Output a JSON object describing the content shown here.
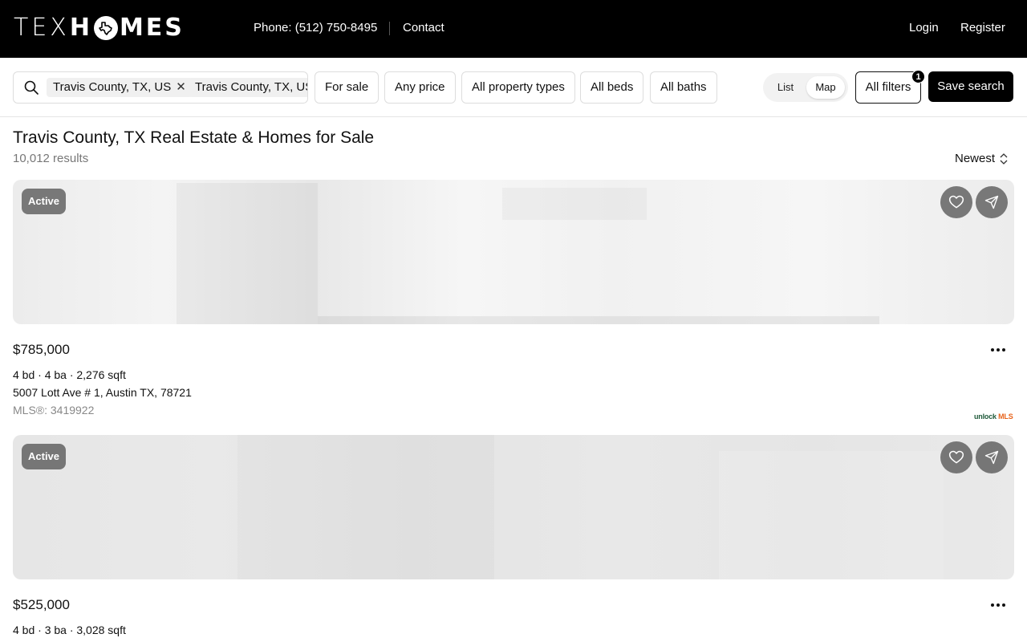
{
  "header": {
    "logo_tex": "TEX",
    "logo_homes_h": "H",
    "logo_homes_rest": "MES",
    "phone": "Phone: (512) 750-8495",
    "contact": "Contact",
    "login": "Login",
    "register": "Register"
  },
  "filters": {
    "search_chips": [
      "Travis County, TX, US",
      "Travis County, TX, US"
    ],
    "listing_type": "For sale",
    "price": "Any price",
    "property_types": "All property types",
    "beds": "All beds",
    "baths": "All baths",
    "view_list": "List",
    "view_map": "Map",
    "all_filters": "All filters",
    "filter_count": "1",
    "save_search": "Save search"
  },
  "results": {
    "title": "Travis County, TX Real Estate & Homes for Sale",
    "count": "10,012 results",
    "sort": "Newest"
  },
  "listings": [
    {
      "status": "Active",
      "price": "$785,000",
      "specs": "4 bd · 4 ba · 2,276 sqft",
      "address": "5007 Lott Ave # 1, Austin TX, 78721",
      "mls": "MLS®: 3419922",
      "provider_a": "unlock",
      "provider_b": "MLS"
    },
    {
      "status": "Active",
      "price": "$525,000",
      "specs": "4 bd · 3 ba · 3,028 sqft"
    }
  ],
  "icons": {
    "search": "search-icon",
    "remove": "close-icon",
    "sort": "sort-icon",
    "favorite": "heart-icon",
    "share": "send-icon",
    "more": "more-options-icon",
    "logo_o": "texas-state-icon"
  },
  "colors": {
    "header_bg": "#000000",
    "primary_button": "#000000",
    "status_badge": "#505050",
    "provider_green": "#1f5a3a",
    "provider_orange": "#e8641c"
  }
}
